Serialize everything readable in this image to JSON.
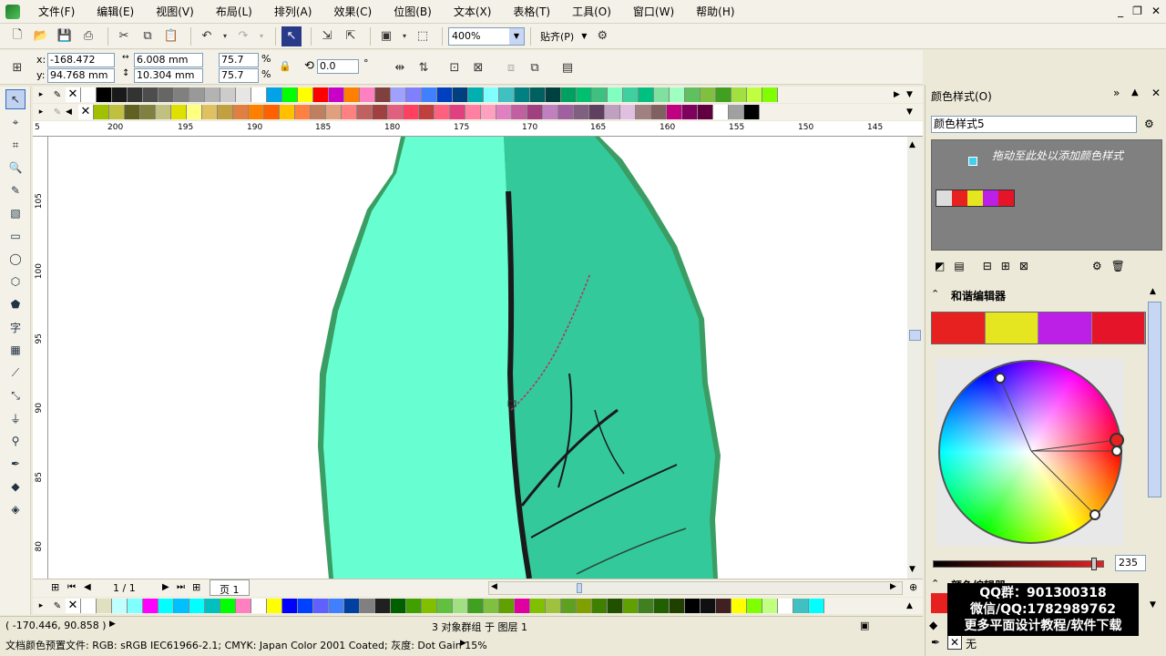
{
  "menu": [
    "文件(F)",
    "编辑(E)",
    "视图(V)",
    "布局(L)",
    "排列(A)",
    "效果(C)",
    "位图(B)",
    "文本(X)",
    "表格(T)",
    "工具(O)",
    "窗口(W)",
    "帮助(H)"
  ],
  "toolbar": {
    "zoom": "400%",
    "snap": "贴齐(P)"
  },
  "props": {
    "x_label": "x:",
    "x": "-168.472 mm",
    "y_label": "y:",
    "y": "94.768 mm",
    "w": "6.008 mm",
    "h": "10.304 mm",
    "sx": "75.7",
    "sy": "75.7",
    "pct": "%",
    "rot": "0.0",
    "deg": "°"
  },
  "palette_top": [
    "#ffffff",
    "#000000",
    "#1a1a1a",
    "#333333",
    "#4d4d4d",
    "#666666",
    "#808080",
    "#999999",
    "#b3b3b3",
    "#cccccc",
    "#e6e6e6",
    "#ffffff",
    "#00a2e8",
    "#00ff00",
    "#ffff00",
    "#ff0000",
    "#c800c8",
    "#ff8000",
    "#ff80c0",
    "#804040",
    "#a0a0ff",
    "#8080ff",
    "#4080ff",
    "#0040c0",
    "#004080",
    "#00b0b0",
    "#80ffff",
    "#40c0c0",
    "#008080",
    "#006060",
    "#004040",
    "#00a060",
    "#00c070",
    "#40c080",
    "#80ffc0",
    "#40d0a0",
    "#00c080",
    "#80e0a0",
    "#a0ffc0",
    "#60c060",
    "#80c040",
    "#40a020",
    "#a0e040",
    "#c0ff40",
    "#80ff00"
  ],
  "palette_mid": [
    "#a0c000",
    "#c0c040",
    "#606020",
    "#808040",
    "#c0c080",
    "#e0e000",
    "#ffff80",
    "#e0c060",
    "#c0a040",
    "#e08040",
    "#ff8000",
    "#ff6000",
    "#ffc000",
    "#ff8040",
    "#c08060",
    "#e0a080",
    "#ff8080",
    "#c06060",
    "#a04040",
    "#e06080",
    "#ff4060",
    "#c04040",
    "#ff6080",
    "#e04080",
    "#ff80a0",
    "#ffa0c0",
    "#e080c0",
    "#c060a0",
    "#a04080",
    "#c080c0",
    "#a060a0",
    "#806080",
    "#604060",
    "#c0a0c0",
    "#e0c0e0",
    "#a08080",
    "#806060",
    "#c00080",
    "#800060",
    "#600040",
    "#ffffff",
    "#a0a0a0",
    "#000000"
  ],
  "palette_bottom": [
    "#ffffff",
    "#e0e0c0",
    "#c0ffff",
    "#80ffff",
    "#ff00ff",
    "#00ffff",
    "#00c0ff",
    "#00ffff",
    "#00c0c0",
    "#00ff00",
    "#ff80c0",
    "#ffffff",
    "#ffff00",
    "#0000ff",
    "#0040ff",
    "#6060ff",
    "#4080ff",
    "#0040a0",
    "#808080",
    "#202020",
    "#006000",
    "#40a000",
    "#80c000",
    "#60c040",
    "#a0e080",
    "#40a020",
    "#80c040",
    "#60a000",
    "#e000a0",
    "#80c000",
    "#a0c040",
    "#60a020",
    "#80a000",
    "#408000",
    "#205000",
    "#60a000",
    "#408020",
    "#206000",
    "#204000",
    "#000000",
    "#101010",
    "#402020",
    "#ffff00",
    "#80ff00",
    "#c0ff80",
    "#ffffff",
    "#40c0c0",
    "#00ffff"
  ],
  "ruler_h": [
    "5",
    "200",
    "195",
    "190",
    "185",
    "180",
    "175",
    "170",
    "165",
    "160",
    "155",
    "150",
    "145"
  ],
  "ruler_v": [
    "105",
    "100",
    "95",
    "90",
    "85",
    "80"
  ],
  "pagebar": {
    "pages": "1 / 1",
    "tab": "页 1"
  },
  "status": {
    "coords": "( -170.446, 90.858 )",
    "selection": "3 对象群组 于 图层 1",
    "profile": "文档颜色预置文件: RGB: sRGB IEC61966-2.1; CMYK: Japan Color 2001 Coated; 灰度: Dot Gain 15%"
  },
  "docker": {
    "title": "颜色样式(O)",
    "style_name": "颜色样式5",
    "drop_hint": "拖动至此处以添加颜色样式",
    "harmony_title": "和谐编辑器",
    "harmony_colors": [
      "#e72020",
      "#e6e620",
      "#bc20e6",
      "#e61428"
    ],
    "slider_value": "235",
    "color_editor": "颜色编辑器",
    "none_label": "无"
  },
  "ad": {
    "line1": "QQ群：901300318",
    "line2": "微信/QQ:1782989762",
    "line3": "更多平面设计教程/软件下载"
  }
}
